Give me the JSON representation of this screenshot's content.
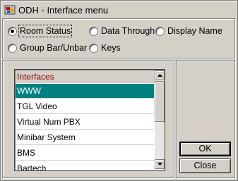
{
  "window": {
    "title": "ODH - Interface menu"
  },
  "filters": {
    "room_status": "Room Status",
    "data_through": "Data Through",
    "display_name": "Display Name",
    "group_bar_unbar": "Group Bar/Unbar",
    "keys": "Keys",
    "selected": "room_status"
  },
  "interfaces": {
    "header": "Interfaces",
    "items": [
      "WWW",
      "TGL Video",
      "Virtual Num PBX",
      "Minibar System",
      "BMS",
      "Bartech"
    ],
    "selected_index": 0
  },
  "buttons": {
    "ok": "OK",
    "close": "Close"
  },
  "colors": {
    "selection": "#008080",
    "header_text": "#8b0000",
    "face": "#d4d0c8"
  },
  "icons": {
    "app": "odh-app-icon",
    "scroll_up": "arrow-up-icon",
    "scroll_down": "arrow-down-icon"
  }
}
